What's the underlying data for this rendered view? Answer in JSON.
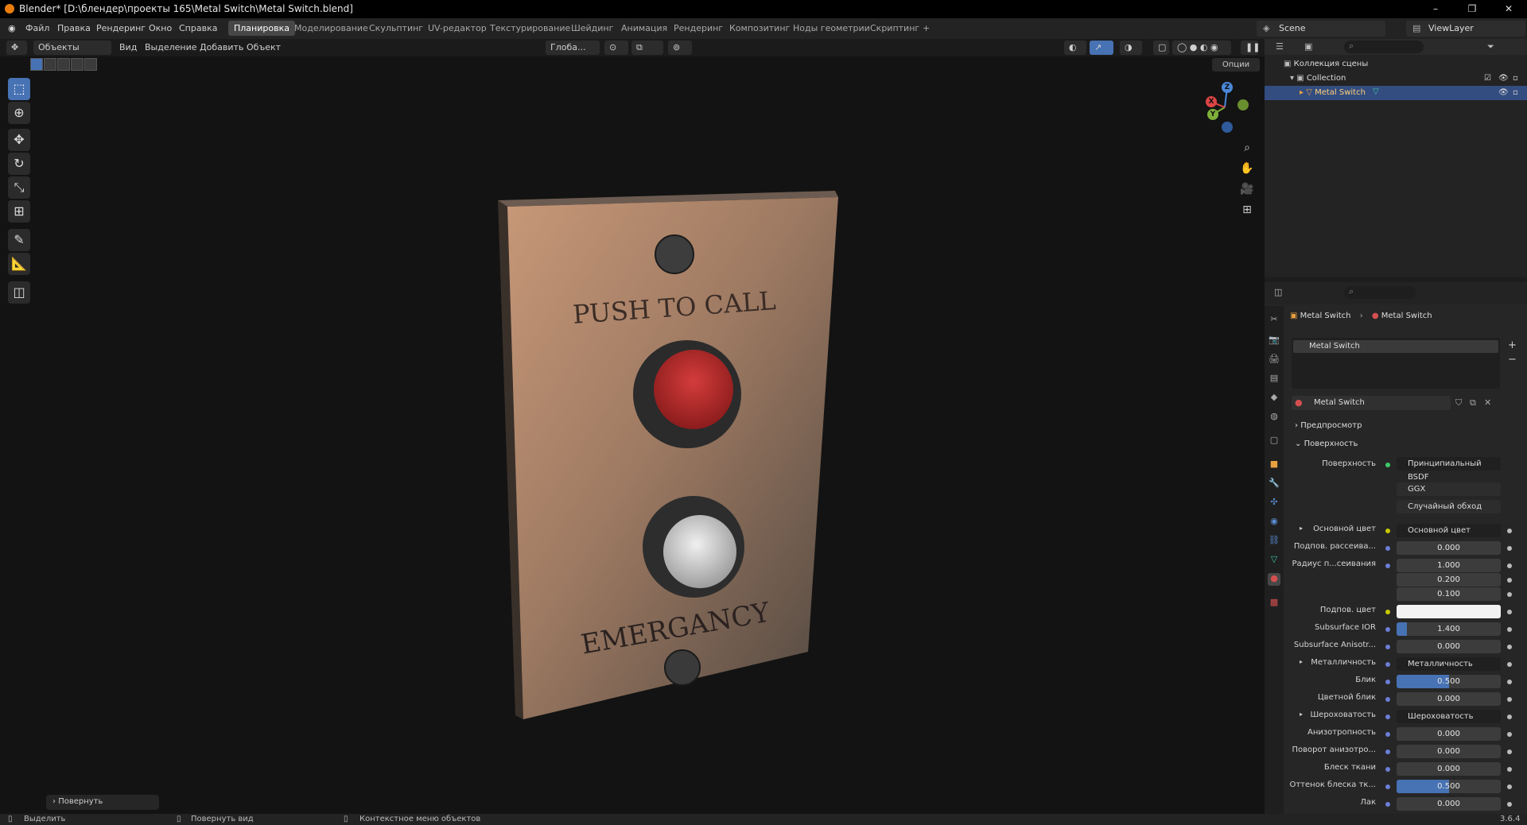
{
  "window": {
    "title": "Blender* [D:\\блендер\\проекты 165\\Metal Switch\\Metal Switch.blend]",
    "minimize": "–",
    "restore": "❐",
    "close": "✕"
  },
  "menu": [
    "Файл",
    "Правка",
    "Рендеринг",
    "Окно",
    "Справка"
  ],
  "workspaces": [
    "Планировка",
    "Моделирование",
    "Скульптинг",
    "UV-редактор",
    "Текстурирование",
    "Шейдинг",
    "Анимация",
    "Рендеринг",
    "Композитинг",
    "Ноды геометрии",
    "Скриптинг"
  ],
  "workspace_add": "+",
  "scene": {
    "name": "Scene",
    "view_layer": "ViewLayer"
  },
  "viewport_header": {
    "mode": "Объекты",
    "menus": [
      "Вид",
      "Выделение",
      "Добавить",
      "Объект"
    ],
    "transform": "Глоба...",
    "options": "Опции"
  },
  "scene_text": {
    "top": "PUSH TO CALL",
    "bottom": "EMERGANCY"
  },
  "last_operation": "Повернуть",
  "outliner": {
    "root": "Коллекция сцены",
    "collection": "Collection",
    "object": "Metal Switch"
  },
  "properties": {
    "breadcrumb": [
      "Metal Switch",
      "Metal Switch"
    ],
    "slot": "Metal Switch",
    "material": "Metal Switch",
    "panels": {
      "preview": "Предпросмотр",
      "surface": "Поверхность"
    },
    "surface_label": "Поверхность",
    "surface_value": "Принципиальный BSDF",
    "distribution": "GGX",
    "sss_method": "Случайный обход",
    "rows": [
      {
        "label": "Основной цвет",
        "link": "Основной цвет",
        "expand": true,
        "dot": "yellow"
      },
      {
        "label": "Подпов. рассеива...",
        "value": "0.000",
        "fill": 0
      },
      {
        "label": "Радиус п...сеивания",
        "value": "1.000",
        "fill": 0
      },
      {
        "label": "",
        "value": "0.200",
        "fill": 0
      },
      {
        "label": "",
        "value": "0.100",
        "fill": 0
      },
      {
        "label": "Подпов. цвет",
        "color": "#f2f2f2",
        "dot": "yellow"
      },
      {
        "label": "Subsurface IOR",
        "value": "1.400",
        "fill": 0.1
      },
      {
        "label": "Subsurface Anisotr...",
        "value": "0.000",
        "fill": 0
      },
      {
        "label": "Металличность",
        "link": "Металличность",
        "expand": true
      },
      {
        "label": "Блик",
        "value": "0.500",
        "fill": 0.5
      },
      {
        "label": "Цветной блик",
        "value": "0.000",
        "fill": 0
      },
      {
        "label": "Шероховатость",
        "link": "Шероховатость",
        "expand": true
      },
      {
        "label": "Анизотропность",
        "value": "0.000",
        "fill": 0
      },
      {
        "label": "Поворот анизотро...",
        "value": "0.000",
        "fill": 0
      },
      {
        "label": "Блеск ткани",
        "value": "0.000",
        "fill": 0
      },
      {
        "label": "Оттенок блеска тк...",
        "value": "0.500",
        "fill": 0.5
      },
      {
        "label": "Лак",
        "value": "0.000",
        "fill": 0
      }
    ]
  },
  "status": {
    "select": "Выделить",
    "rotate": "Повернуть вид",
    "context": "Контекстное меню объектов",
    "version": "3.6.4"
  }
}
